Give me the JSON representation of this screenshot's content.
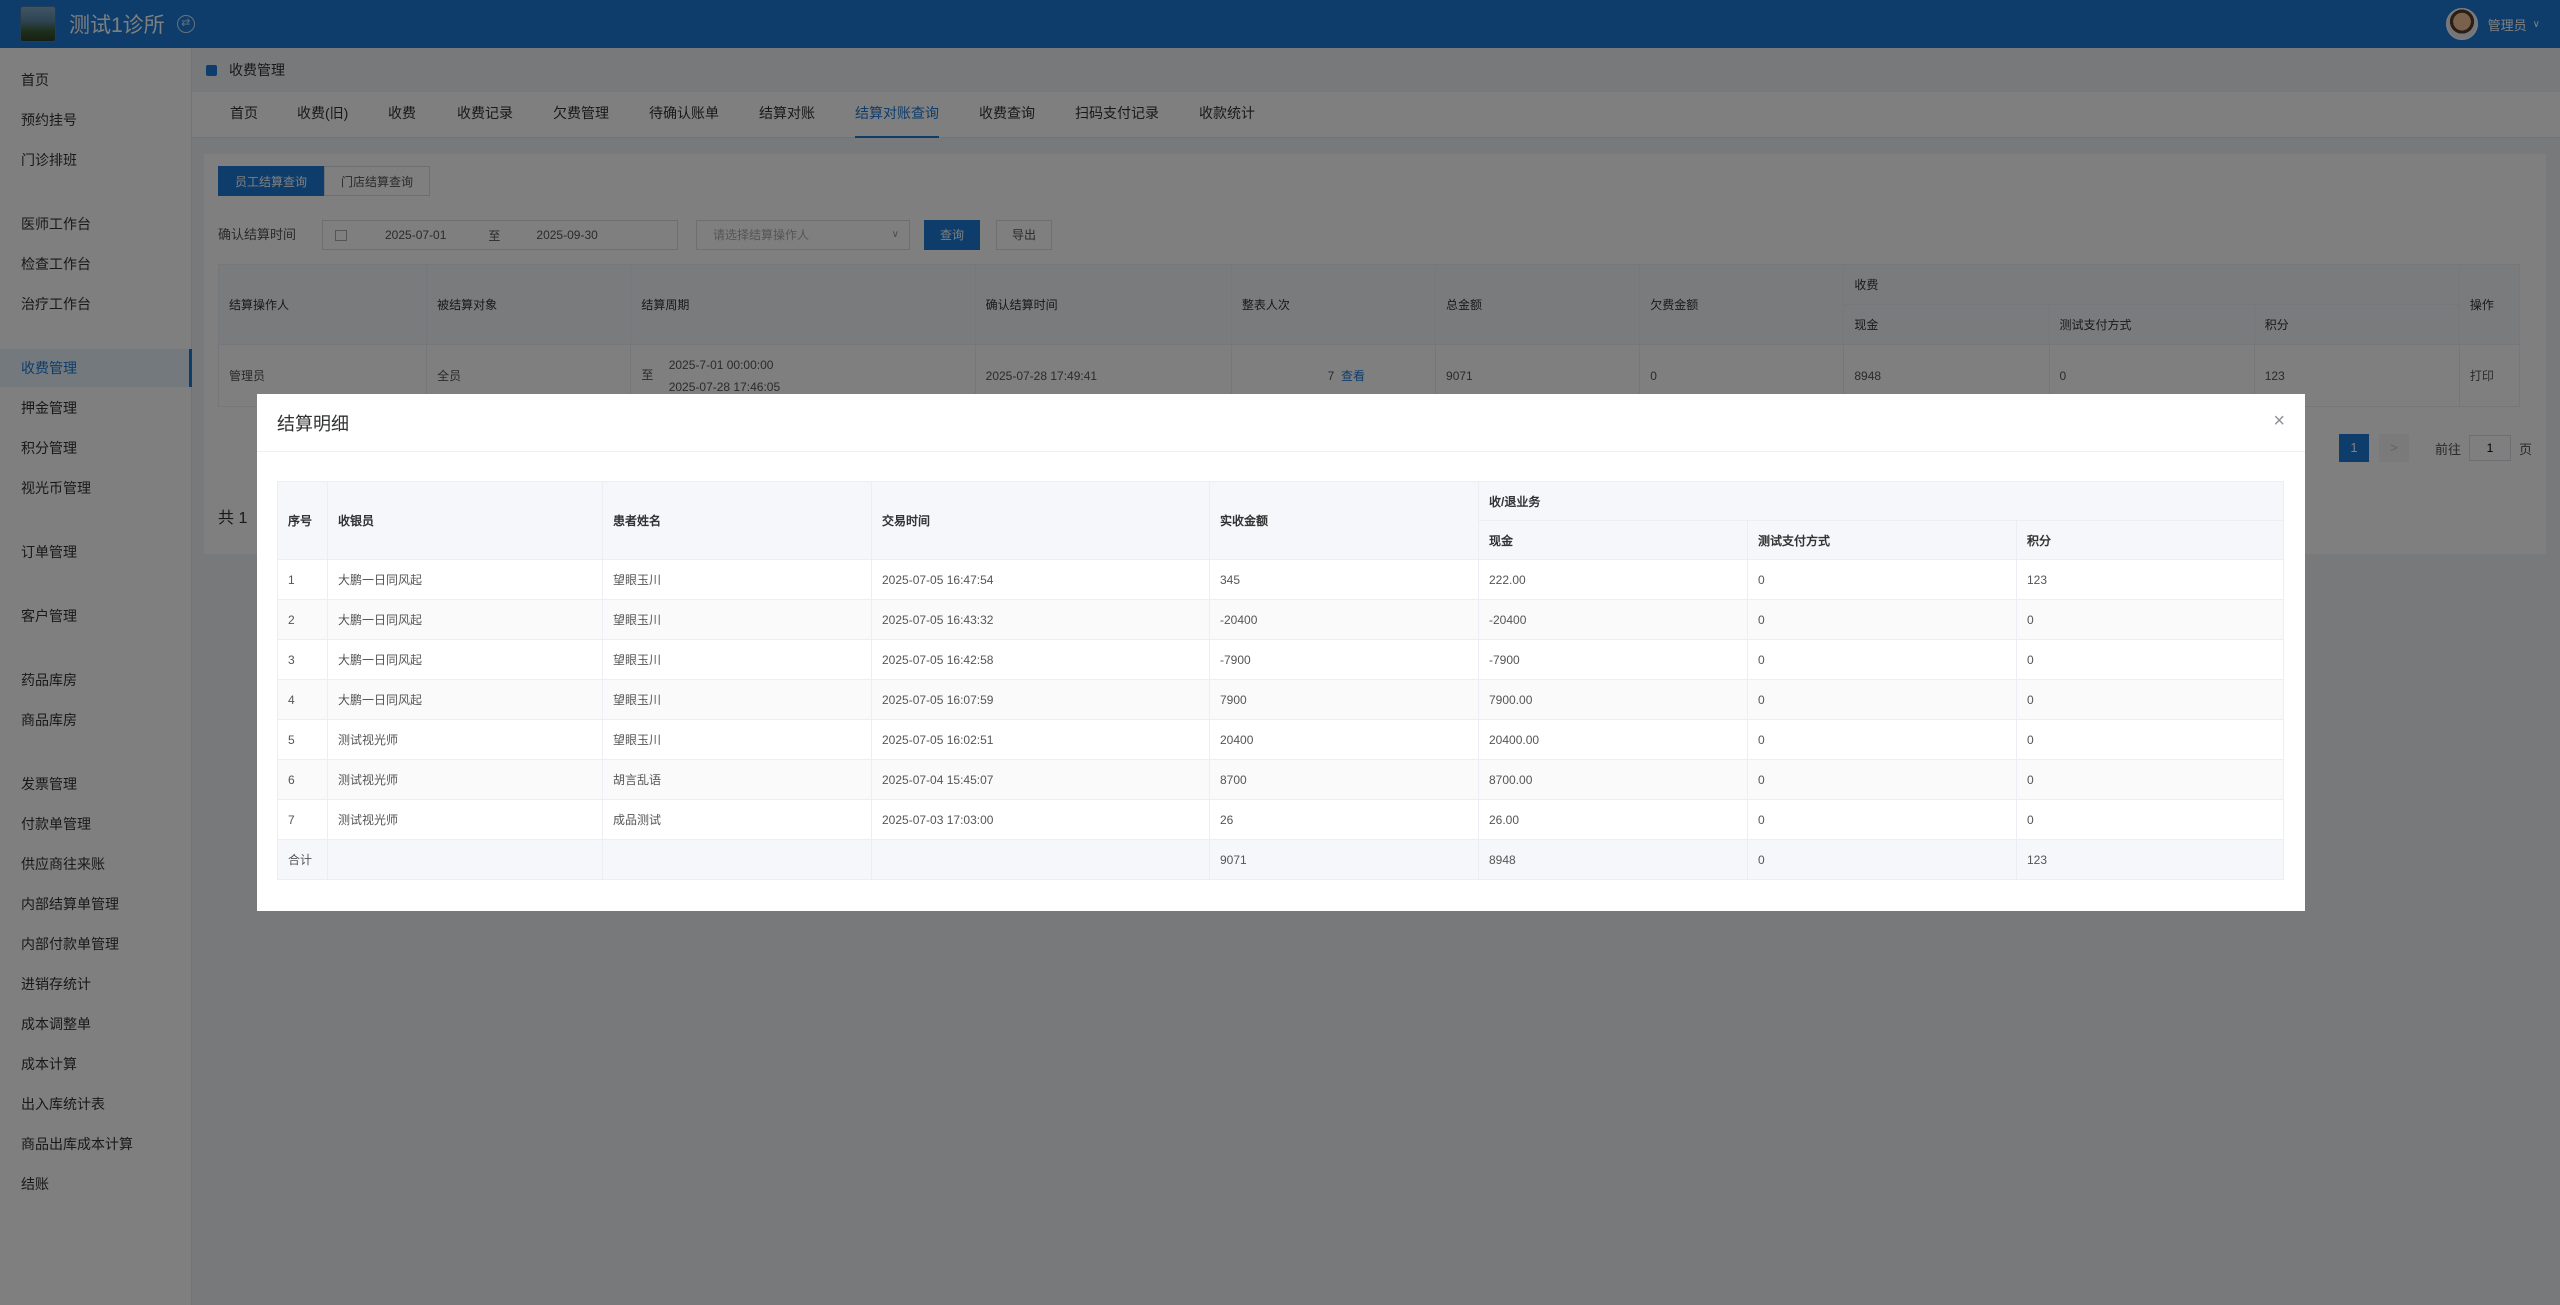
{
  "header": {
    "clinic_name": "测试1诊所",
    "user_name": "管理员"
  },
  "sidebar": {
    "items": [
      {
        "label": "首页",
        "active": false
      },
      {
        "label": "预约挂号",
        "active": false
      },
      {
        "label": "门诊排班",
        "active": false
      },
      {
        "label": "医师工作台",
        "active": false
      },
      {
        "label": "检查工作台",
        "active": false
      },
      {
        "label": "治疗工作台",
        "active": false
      },
      {
        "label": "收费管理",
        "active": true
      },
      {
        "label": "押金管理",
        "active": false
      },
      {
        "label": "积分管理",
        "active": false
      },
      {
        "label": "视光币管理",
        "active": false
      },
      {
        "label": "订单管理",
        "active": false
      },
      {
        "label": "客户管理",
        "active": false
      },
      {
        "label": "药品库房",
        "active": false
      },
      {
        "label": "商品库房",
        "active": false
      },
      {
        "label": "发票管理",
        "active": false
      },
      {
        "label": "付款单管理",
        "active": false
      },
      {
        "label": "供应商往来账",
        "active": false
      },
      {
        "label": "内部结算单管理",
        "active": false
      },
      {
        "label": "内部付款单管理",
        "active": false
      },
      {
        "label": "进销存统计",
        "active": false
      },
      {
        "label": "成本调整单",
        "active": false
      },
      {
        "label": "成本计算",
        "active": false
      },
      {
        "label": "出入库统计表",
        "active": false
      },
      {
        "label": "商品出库成本计算",
        "active": false
      },
      {
        "label": "结账",
        "active": false
      }
    ]
  },
  "page": {
    "section_title": "收费管理",
    "tabs": [
      "首页",
      "收费(旧)",
      "收费",
      "收费记录",
      "欠费管理",
      "待确认账单",
      "结算对账",
      "结算对账查询",
      "收费查询",
      "扫码支付记录",
      "收款统计"
    ],
    "active_tab": "结算对账查询",
    "segments": [
      "员工结算查询",
      "门店结算查询"
    ],
    "filter": {
      "label": "确认结算时间",
      "date_start": "2025-07-01",
      "date_sep": "至",
      "date_end": "2025-09-30",
      "operator_placeholder": "请选择结算操作人",
      "query_label": "查询",
      "export_label": "导出"
    },
    "table": {
      "headers": {
        "operator": "结算操作人",
        "target": "被结算对象",
        "period": "结算周期",
        "confirm_time": "确认结算时间",
        "count": "整表人次",
        "total": "总金额",
        "owed": "欠费金额",
        "group": "收费",
        "cash": "现金",
        "test_pay": "测试支付方式",
        "points": "积分",
        "action": "操作"
      },
      "row": {
        "operator": "管理员",
        "target": "全员",
        "period_prefix": "至",
        "period_start": "2025-7-01 00:00:00",
        "period_end": "2025-07-28 17:46:05",
        "confirm_time": "2025-07-28 17:49:41",
        "count": "7",
        "view_label": "查看",
        "total": "9071",
        "owed": "0",
        "cash": "8948",
        "test_pay": "0",
        "points": "123",
        "action": "打印"
      }
    },
    "total_text": "共 1",
    "pager": {
      "current": "1",
      "next": ">",
      "goto_label": "前往",
      "goto_value": "1",
      "page_label": "页"
    }
  },
  "dialog": {
    "title": "结算明细",
    "close": "×",
    "headers": {
      "index": "序号",
      "cashier": "收银员",
      "patient": "患者姓名",
      "time": "交易时间",
      "amount": "实收金额",
      "group": "收/退业务",
      "cash": "现金",
      "test_pay": "测试支付方式",
      "points": "积分"
    },
    "rows": [
      {
        "index": "1",
        "cashier": "大鹏一日同风起",
        "patient": "望眼玉川",
        "time": "2025-07-05 16:47:54",
        "amount": "345",
        "cash": "222.00",
        "test_pay": "0",
        "points": "123"
      },
      {
        "index": "2",
        "cashier": "大鹏一日同风起",
        "patient": "望眼玉川",
        "time": "2025-07-05 16:43:32",
        "amount": "-20400",
        "cash": "-20400",
        "test_pay": "0",
        "points": "0"
      },
      {
        "index": "3",
        "cashier": "大鹏一日同风起",
        "patient": "望眼玉川",
        "time": "2025-07-05 16:42:58",
        "amount": "-7900",
        "cash": "-7900",
        "test_pay": "0",
        "points": "0"
      },
      {
        "index": "4",
        "cashier": "大鹏一日同风起",
        "patient": "望眼玉川",
        "time": "2025-07-05 16:07:59",
        "amount": "7900",
        "cash": "7900.00",
        "test_pay": "0",
        "points": "0"
      },
      {
        "index": "5",
        "cashier": "测试视光师",
        "patient": "望眼玉川",
        "time": "2025-07-05 16:02:51",
        "amount": "20400",
        "cash": "20400.00",
        "test_pay": "0",
        "points": "0"
      },
      {
        "index": "6",
        "cashier": "测试视光师",
        "patient": "胡言乱语",
        "time": "2025-07-04 15:45:07",
        "amount": "8700",
        "cash": "8700.00",
        "test_pay": "0",
        "points": "0"
      },
      {
        "index": "7",
        "cashier": "测试视光师",
        "patient": "成品测试",
        "time": "2025-07-03 17:03:00",
        "amount": "26",
        "cash": "26.00",
        "test_pay": "0",
        "points": "0"
      }
    ],
    "summary": {
      "label": "合计",
      "amount": "9071",
      "cash": "8948",
      "test_pay": "0",
      "points": "123"
    }
  }
}
